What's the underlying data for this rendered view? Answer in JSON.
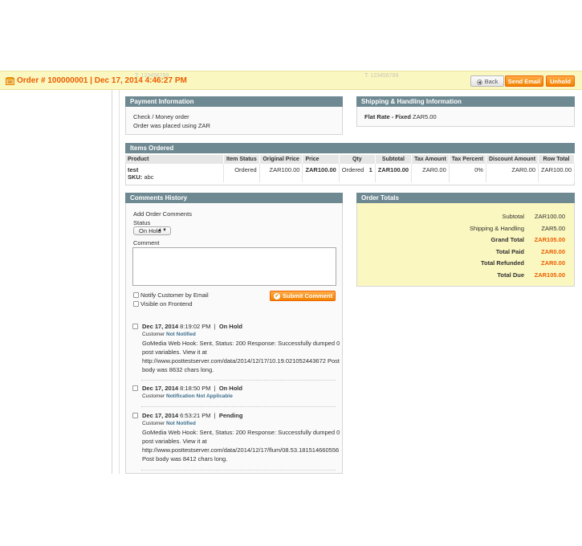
{
  "header": {
    "title": "Order # 100000001 | Dec 17, 2014 4:46:27 PM",
    "ghost_text_left": "T: 123456789",
    "ghost_text_right": "T: 123456789",
    "back_label": "Back",
    "send_email_label": "Send Email",
    "unhold_label": "Unhold"
  },
  "payment": {
    "heading": "Payment Information",
    "method": "Check / Money order",
    "currency_note": "Order was placed using ZAR"
  },
  "shipping": {
    "heading": "Shipping & Handling Information",
    "method_bold": "Flat Rate - Fixed",
    "amount": "ZAR5.00"
  },
  "items": {
    "heading": "Items Ordered",
    "columns": [
      "Product",
      "Item Status",
      "Original Price",
      "Price",
      "Qty",
      "Subtotal",
      "Tax Amount",
      "Tax Percent",
      "Discount Amount",
      "Row Total"
    ],
    "rows": [
      {
        "product": "test",
        "sku_label": "SKU:",
        "sku": "abc",
        "status": "Ordered",
        "original_price": "ZAR100.00",
        "price": "ZAR100.00",
        "qty_label": "Ordered",
        "qty": "1",
        "subtotal": "ZAR100.00",
        "tax_amount": "ZAR0.00",
        "tax_percent": "0%",
        "discount": "ZAR0.00",
        "row_total": "ZAR100.00"
      }
    ]
  },
  "comments": {
    "heading": "Comments History",
    "add_label": "Add Order Comments",
    "status_label": "Status",
    "status_value": "On Hold",
    "comment_label": "Comment",
    "notify_label": "Notify Customer by Email",
    "visible_label": "Visible on Frontend",
    "submit_label": "Submit Comment",
    "history": [
      {
        "date": "Dec 17, 2014",
        "time": "8:19:02 PM",
        "status": "On Hold",
        "customer_label": "Customer",
        "notification": "Not Notified",
        "lines": [
          "GoMedia Web Hook: Sent, Status: 200 Response: Successfully dumped 0",
          "post variables. View it at",
          "http://www.posttestserver.com/data/2014/12/17/10.19.021052443672 Post",
          "body was 8632 chars long."
        ]
      },
      {
        "date": "Dec 17, 2014",
        "time": "8:18:50 PM",
        "status": "On Hold",
        "customer_label": "Customer",
        "notification": "Notification Not Applicable",
        "lines": []
      },
      {
        "date": "Dec 17, 2014",
        "time": "6:53:21 PM",
        "status": "Pending",
        "customer_label": "Customer",
        "notification": "Not Notified",
        "lines": [
          "GoMedia Web Hook: Sent, Status: 200 Response: Successfully dumped 0",
          "post variables. View it at",
          "http://www.posttestserver.com/data/2014/12/17/flum/08.53.181514660556",
          "Post body was 8412 chars long."
        ]
      }
    ]
  },
  "totals": {
    "heading": "Order Totals",
    "subtotal_label": "Subtotal",
    "subtotal": "ZAR100.00",
    "shipping_label": "Shipping & Handling",
    "shipping": "ZAR5.00",
    "grand_label": "Grand Total",
    "grand": "ZAR105.00",
    "paid_label": "Total Paid",
    "paid": "ZAR0.00",
    "refunded_label": "Total Refunded",
    "refunded": "ZAR0.00",
    "due_label": "Total Due",
    "due": "ZAR105.00"
  },
  "colors": {
    "header_bg": "#fbf7c0",
    "accent_orange": "#eb5e00",
    "box_header": "#6f8992",
    "link_blue": "#3d6e8d"
  }
}
